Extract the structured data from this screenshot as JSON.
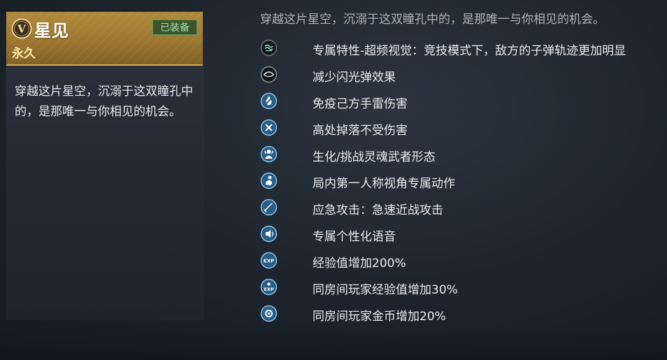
{
  "item": {
    "name": "星见",
    "duration": "永久",
    "equip_status": "已装备",
    "rank_letter": "V",
    "description": "穿越这片星空，沉溺于这双瞳孔中的，是那唯一与你相见的机会。",
    "accent_color": "#a8843a"
  },
  "details": {
    "intro": "穿越这片星空，沉溺于这双瞳孔中的，是那唯一与你相见的机会。",
    "features": [
      {
        "icon": "wave-vision-icon",
        "label": "专属特性-超频视觉：竞技模式下，敌方的子弹轨迹更加明显"
      },
      {
        "icon": "eye-flash-icon",
        "label": "减少闪光弹效果"
      },
      {
        "icon": "grenade-immune-icon",
        "label": "免疫己方手雷伤害"
      },
      {
        "icon": "fall-immune-icon",
        "label": "高处掉落不受伤害"
      },
      {
        "icon": "soul-warrior-icon",
        "label": "生化/挑战灵魂武者形态"
      },
      {
        "icon": "first-person-action-icon",
        "label": "局内第一人称视角专属动作"
      },
      {
        "icon": "melee-attack-icon",
        "label": "应急攻击：急速近战攻击"
      },
      {
        "icon": "voice-icon",
        "label": "专属个性化语音"
      },
      {
        "icon": "exp-icon",
        "label": "经验值增加200%"
      },
      {
        "icon": "room-exp-icon",
        "label": "同房间玩家经验值增加30%"
      },
      {
        "icon": "room-gold-icon",
        "label": "同房间玩家金币增加20%"
      }
    ]
  }
}
